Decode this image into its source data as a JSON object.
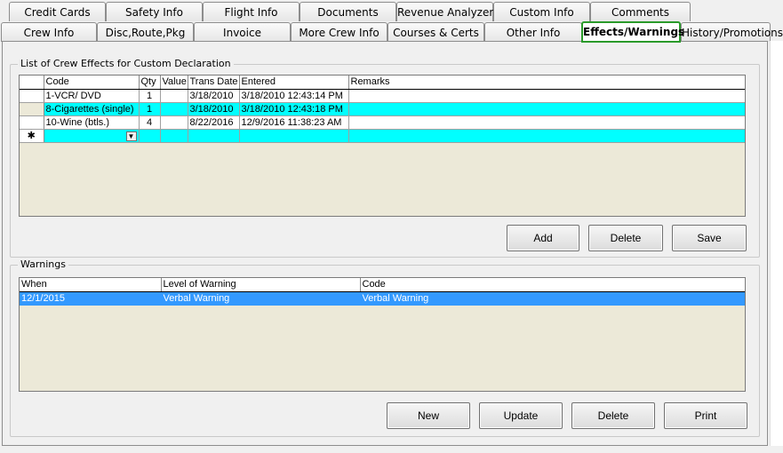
{
  "tabs_row1": [
    "Credit Cards",
    "Safety Info",
    "Flight Info",
    "Documents",
    "Revenue Analyzer",
    "Custom Info",
    "Comments"
  ],
  "tabs_row2": [
    "Crew Info",
    "Disc,Route,Pkg",
    "Invoice",
    "More Crew Info",
    "Courses & Certs",
    "Other Info",
    "Effects/Warnings",
    "History/Promotions"
  ],
  "active_tab": "Effects/Warnings",
  "effects": {
    "title": "List of Crew Effects for Custom Declaration",
    "columns": [
      "Code",
      "Qty",
      "Value",
      "Trans Date",
      "Entered",
      "Remarks"
    ],
    "rows": [
      {
        "code": "1-VCR/ DVD",
        "qty": "1",
        "value": "",
        "trans_date": "3/18/2010",
        "entered": "3/18/2010 12:43:14 PM",
        "remarks": ""
      },
      {
        "code": "8-Cigarettes (single)",
        "qty": "1",
        "value": "",
        "trans_date": "3/18/2010",
        "entered": "3/18/2010 12:43:18 PM",
        "remarks": ""
      },
      {
        "code": "10-Wine (btls.)",
        "qty": "4",
        "value": "",
        "trans_date": "8/22/2016",
        "entered": "12/9/2016 11:38:23 AM",
        "remarks": ""
      }
    ],
    "new_row_marker": "✱",
    "buttons": {
      "add": "Add",
      "delete": "Delete",
      "save": "Save"
    }
  },
  "warnings": {
    "title": "Warnings",
    "columns": [
      "When",
      "Level of Warning",
      "Code"
    ],
    "rows": [
      {
        "when": "12/1/2015",
        "level": "Verbal Warning",
        "code": "Verbal Warning"
      }
    ],
    "buttons": {
      "new": "New",
      "update": "Update",
      "delete": "Delete",
      "print": "Print"
    }
  },
  "colors": {
    "new_row": "#00ffff",
    "selected_row": "#3399ff",
    "active_tab_border": "#2a9a2a"
  }
}
